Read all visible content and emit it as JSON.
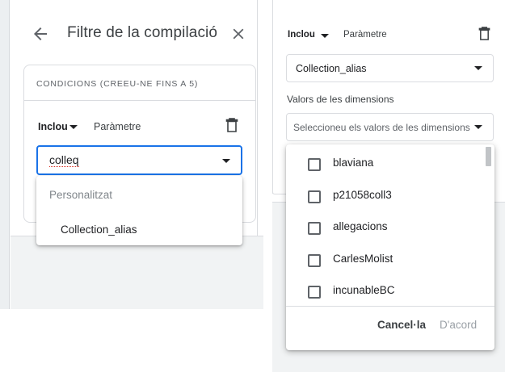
{
  "left_panel": {
    "title": "Filtre de la compilació",
    "conditions_heading": "CONDICIONS (CREEU-NE FINS A 5)",
    "include_label": "Inclou",
    "parameter_label": "Paràmetre",
    "search_value": "colleq",
    "suggestions": {
      "group_label": "Personalitzat",
      "items": [
        "Collection_alias"
      ]
    }
  },
  "right_panel": {
    "include_label": "Inclou",
    "parameter_label": "Paràmetre",
    "selected_dimension": "Collection_alias",
    "dimension_values_label": "Valors de les dimensions",
    "values_placeholder": "Seleccioneu els valors de les dimensions",
    "values": [
      "blaviana",
      "p21058coll3",
      "allegacions",
      "CarlesMolist",
      "incunableBC"
    ],
    "cancel_label": "Cancel·la",
    "ok_label": "D'acord"
  },
  "icons": {
    "back": "arrow-back-icon",
    "close": "close-icon",
    "delete": "trash-icon",
    "dropdown": "caret-down-icon"
  },
  "colors": {
    "accent": "#1a73e8",
    "divider": "#dadce0",
    "muted_text": "#5f6368",
    "disabled_text": "#9aa0a6"
  }
}
